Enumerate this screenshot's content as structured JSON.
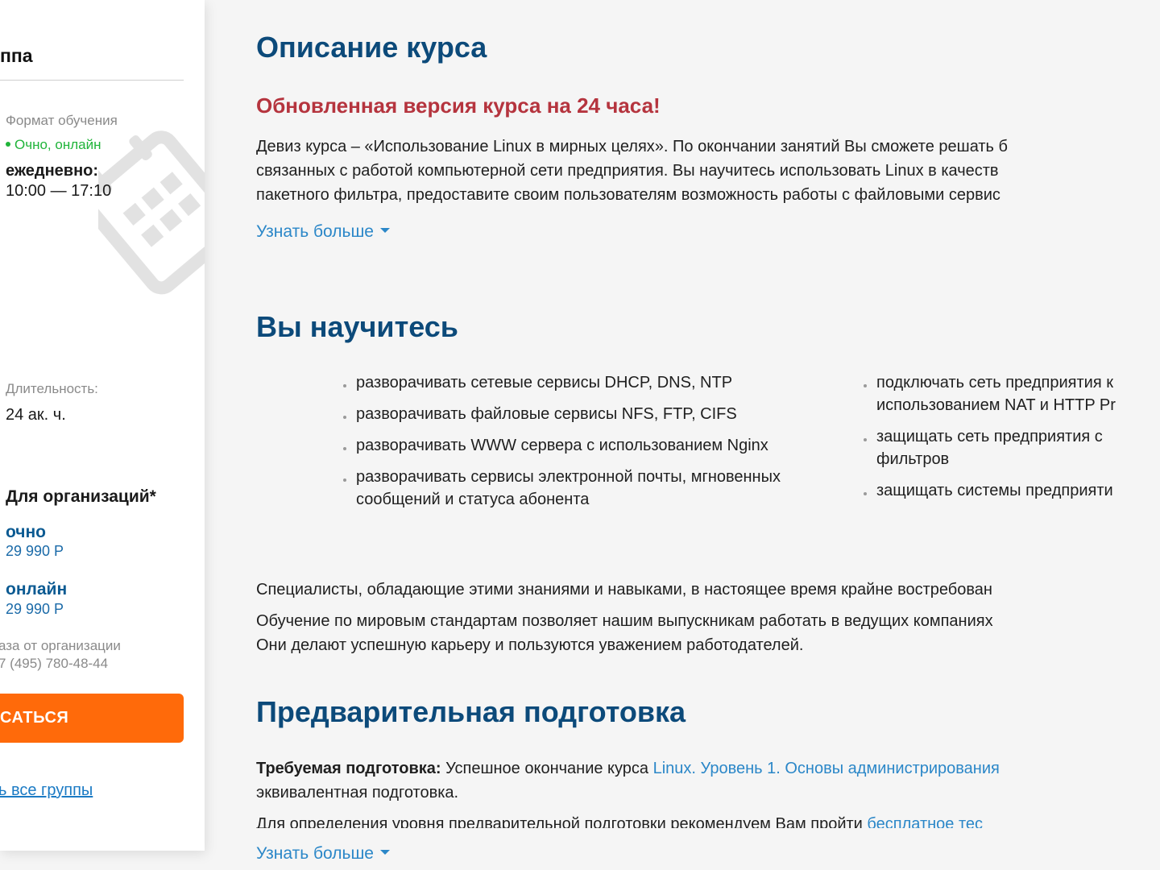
{
  "sidebar": {
    "title_fragment": "ппа",
    "format_label": "Формат обучения",
    "format_value": "Очно, онлайн",
    "schedule_label": "ежедневно:",
    "schedule_time": "10:00 — 17:10",
    "duration_label": "Длительность:",
    "duration_value": "24 ак. ч.",
    "org_title": "Для организаций*",
    "mode_offline": "очно",
    "price_offline": "29 990 Р",
    "mode_online": "онлайн",
    "price_online": "29 990 Р",
    "org_order_note": "аза от организации",
    "org_phone": "7 (495) 780-48-44",
    "signup_button": "САТЬСЯ",
    "all_groups_link": "ь все группы",
    "calendar_icon": "calendar-icon"
  },
  "description": {
    "title": "Описание курса",
    "highlight": "Обновленная версия курса на 24 часа!",
    "lines": [
      "Девиз курса – «Использование Linux в мирных целях». По окончании занятий Вы сможете решать б",
      "связанных с работой компьютерной сети предприятия. Вы научитесь использовать Linux в качеств",
      "пакетного фильтра, предоставите своим пользователям возможность работы с файловыми сервис"
    ],
    "more": "Узнать больше"
  },
  "learn": {
    "title": "Вы научитесь",
    "col1": [
      "разворачивать сетевые сервисы DHCP, DNS, NTP",
      "разворачивать файловые сервисы NFS, FTP, CIFS",
      "разворачивать WWW сервера с использованием Nginx",
      "разворачивать сервисы электронной почты, мгновенных сообщений и статуса абонента"
    ],
    "col2": [
      "подключать сеть предприятия к использованием NAT и HTTP Pr",
      "защищать сеть предприятия с фильтров",
      "защищать системы предприяти"
    ],
    "specialists": "Специалисты, обладающие этими знаниями и навыками, в настоящее время крайне востребован",
    "standards_1": "Обучение по мировым стандартам позволяет нашим выпускникам работать в ведущих компаниях",
    "standards_2": "Они делают успешную карьеру и пользуются уважением работодателей."
  },
  "prereq": {
    "title": "Предварительная подготовка",
    "label": "Требуемая подготовка:",
    "text_before": " Успешное окончание курса ",
    "link": "Linux. Уровень 1. Основы администрирования",
    "line2": "эквивалентная подготовка.",
    "test_text": "Для определения уровня предварительной подготовки рекомендуем Вам пройти ",
    "test_link": "бесплатное тес",
    "more": "Узнать больше"
  }
}
